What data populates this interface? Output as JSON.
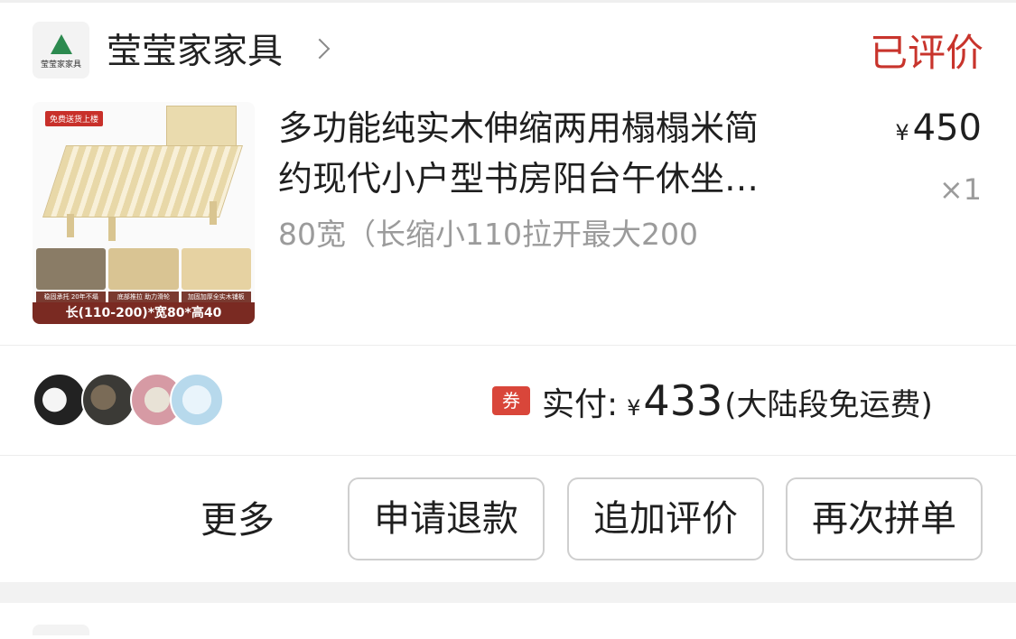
{
  "store": {
    "logo_text": "莹莹家家具",
    "name": "莹莹家家具",
    "status": "已评价"
  },
  "product": {
    "image_tag": "免费送货上楼",
    "image_caps": [
      "稳固承托 20年不塌",
      "底部推拉 助力滑轮",
      "加固加厚全实木铺板"
    ],
    "image_footer": "长(110-200)*宽80*高40",
    "title_line1": "多功能纯实木伸缩两用榻榻米简",
    "title_line2": "约现代小户型书房阳台午休坐…",
    "spec": "80宽（长缩小110拉开最大200",
    "price_symbol": "¥",
    "price": "450",
    "quantity": "×1"
  },
  "summary": {
    "coupon_label": "券",
    "paid_label": "实付:",
    "paid_symbol": "¥",
    "paid_amount": "433",
    "shipping_note": "(大陆段免运费)"
  },
  "actions": {
    "more": "更多",
    "refund": "申请退款",
    "add_review": "追加评价",
    "reorder": "再次拼单"
  },
  "colors": {
    "status_red": "#c8342c",
    "coupon_red": "#d9463a"
  }
}
